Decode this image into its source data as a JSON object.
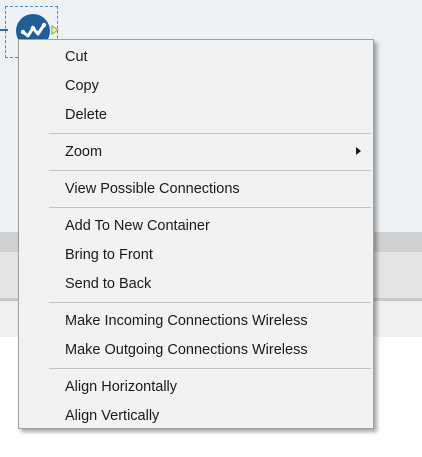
{
  "canvas": {
    "tool_icon": "check-circle-icon",
    "tool_color": "#1f5f99"
  },
  "context_menu": {
    "items": [
      {
        "id": "cut",
        "label": "Cut"
      },
      {
        "id": "copy",
        "label": "Copy"
      },
      {
        "id": "delete",
        "label": "Delete"
      },
      {
        "id": "zoom",
        "label": "Zoom",
        "submenu": true,
        "submenu_icon": "chevron-right-icon"
      },
      {
        "id": "view-possible-connections",
        "label": "View Possible Connections"
      },
      {
        "id": "add-to-new-container",
        "label": "Add To New Container"
      },
      {
        "id": "bring-to-front",
        "label": "Bring to Front"
      },
      {
        "id": "send-to-back",
        "label": "Send to Back"
      },
      {
        "id": "make-incoming-wireless",
        "label": "Make Incoming Connections Wireless"
      },
      {
        "id": "make-outgoing-wireless",
        "label": "Make Outgoing Connections Wireless"
      },
      {
        "id": "align-horizontally",
        "label": "Align Horizontally"
      },
      {
        "id": "align-vertically",
        "label": "Align Vertically"
      }
    ]
  }
}
